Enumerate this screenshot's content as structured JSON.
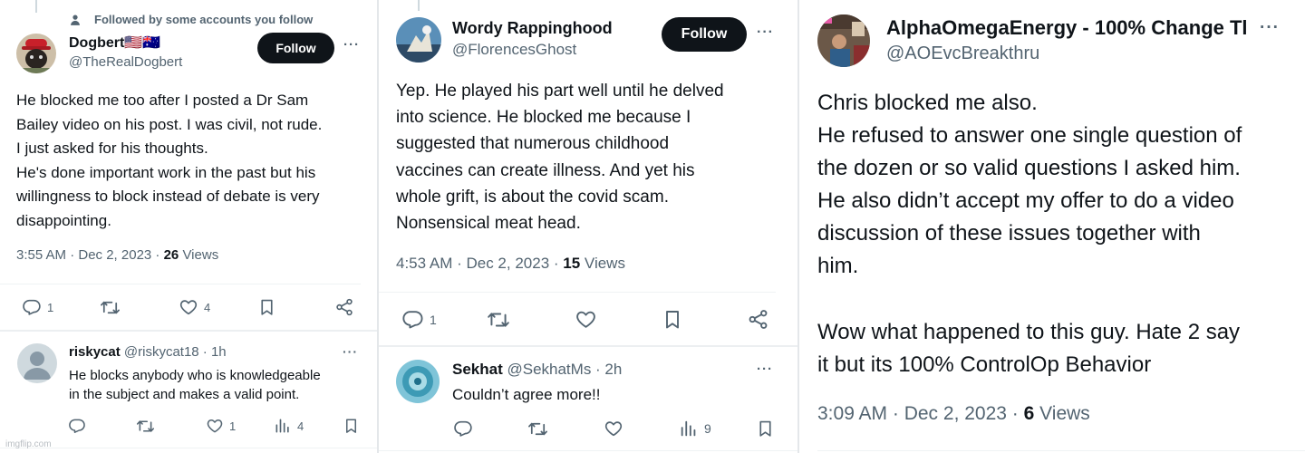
{
  "panels": [
    {
      "social_context": "Followed by some accounts you follow",
      "author": {
        "name": "Dogbert🇺🇸🇦🇺",
        "handle": "@TheRealDogbert"
      },
      "follow_label": "Follow",
      "more_label": "···",
      "text": "He blocked me too after I posted a Dr Sam\nBailey video on his post. I was civil, not rude.\nI just asked for his thoughts.\nHe's done important work in the past but his\nwillingness to block instead of debate is very\ndisappointing.",
      "time": "3:55 AM · Dec 2, 2023 · ",
      "views_count": "26",
      "views_label": " Views",
      "actions": {
        "replies": "1",
        "reposts": "",
        "likes": "4"
      },
      "reply": {
        "name": "riskycat",
        "meta": " @riskycat18 · 1h",
        "more_label": "···",
        "text": "He blocks anybody who is knowledgeable\nin the subject and makes a valid point.",
        "actions": {
          "replies": "",
          "reposts": "",
          "likes": "1",
          "views": "4"
        }
      }
    },
    {
      "author": {
        "name": "Wordy Rappinghood",
        "handle": "@FlorencesGhost"
      },
      "follow_label": "Follow",
      "more_label": "···",
      "text": "Yep. He played his part well until he delved\ninto science. He blocked me because I\nsuggested that numerous childhood\nvaccines can create illness. And yet his\nwhole grift, is about the covid scam.\nNonsensical meat head.",
      "time": "4:53 AM · Dec 2, 2023 · ",
      "views_count": "15",
      "views_label": " Views",
      "actions": {
        "replies": "1",
        "reposts": "",
        "likes": ""
      },
      "reply": {
        "name": "Sekhat",
        "meta": " @SekhatMs · 2h",
        "more_label": "···",
        "text": "Couldn’t agree more!!",
        "actions": {
          "replies": "",
          "reposts": "",
          "likes": "",
          "views": "9"
        }
      }
    },
    {
      "author": {
        "name": "AlphaOmegaEnergy - 100% Change Tl",
        "handle": "@AOEvcBreakthru"
      },
      "more_label": "···",
      "text": "Chris blocked me also.\nHe refused to answer one single question of\nthe dozen or so valid questions I asked him.\nHe also didn’t accept my offer to do a video\ndiscussion of these issues together with\nhim.\n\nWow what happened to this guy. Hate 2 say\nit but its 100% ControlOp Behavior",
      "time": "3:09 AM · Dec 2, 2023 · ",
      "views_count": "6",
      "views_label": " Views"
    }
  ],
  "watermark": "imgflip.com",
  "colors": {
    "text": "#0f1419",
    "secondary": "#536471",
    "button_bg": "#0f1419",
    "button_text": "#ffffff",
    "divider": "#eff3f4"
  },
  "icons": [
    "person-icon",
    "reply-icon",
    "repost-icon",
    "like-icon",
    "bookmark-icon",
    "share-icon",
    "views-icon",
    "more-icon"
  ]
}
